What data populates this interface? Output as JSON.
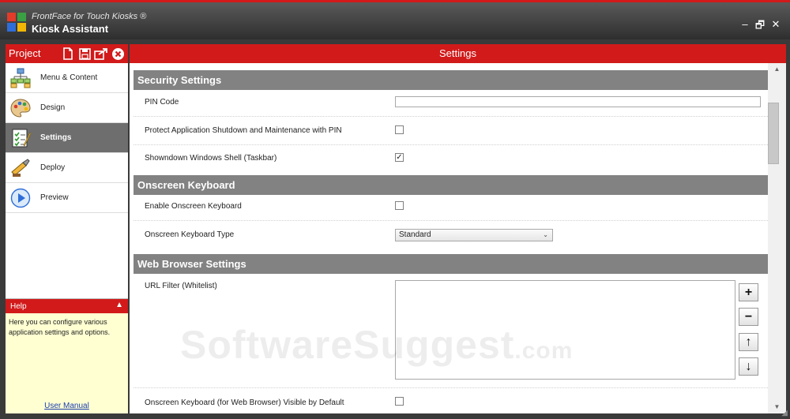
{
  "window": {
    "subtitle": "FrontFace for Touch Kiosks ®",
    "title": "Kiosk Assistant",
    "controls": {
      "minimize": "–",
      "restore": "🗗",
      "close": "✕"
    }
  },
  "project": {
    "label": "Project",
    "tools": [
      "new-file-icon",
      "save-icon",
      "export-icon",
      "close-icon"
    ]
  },
  "nav": {
    "items": [
      {
        "label": "Menu & Content",
        "icon": "menu-tree-icon"
      },
      {
        "label": "Design",
        "icon": "palette-icon"
      },
      {
        "label": "Settings",
        "icon": "checklist-icon",
        "active": true
      },
      {
        "label": "Deploy",
        "icon": "deploy-icon"
      },
      {
        "label": "Preview",
        "icon": "play-icon"
      }
    ]
  },
  "help": {
    "title": "Help",
    "text": "Here you can configure various application settings and options.",
    "link": "User Manual"
  },
  "settings": {
    "header": "Settings",
    "sections": {
      "security": "Security Settings",
      "keyboard": "Onscreen Keyboard",
      "browser": "Web Browser Settings"
    },
    "rows": {
      "pin": {
        "label": "PIN Code",
        "value": ""
      },
      "protect": {
        "label": "Protect Application Shutdown and Maintenance with PIN",
        "checked": false
      },
      "shell": {
        "label": "Showndown Windows Shell (Taskbar)",
        "checked": true
      },
      "enable_kb": {
        "label": "Enable Onscreen Keyboard",
        "checked": false
      },
      "kb_type": {
        "label": "Onscreen Keyboard Type",
        "value": "Standard"
      },
      "url_filter": {
        "label": "URL Filter (Whitelist)",
        "buttons": [
          "+",
          "−",
          "↑",
          "↓"
        ]
      },
      "kb_visible": {
        "label": "Onscreen Keyboard (for Web Browser) Visible by Default",
        "checked": false
      }
    },
    "check_glyph": "✓"
  },
  "watermark": {
    "main": "SoftwareSuggest",
    "suffix": ".com"
  },
  "colors": {
    "accent": "#d21a1a",
    "section": "#828282",
    "active_nav": "#6e6e6e",
    "help_bg": "#ffffd2"
  }
}
